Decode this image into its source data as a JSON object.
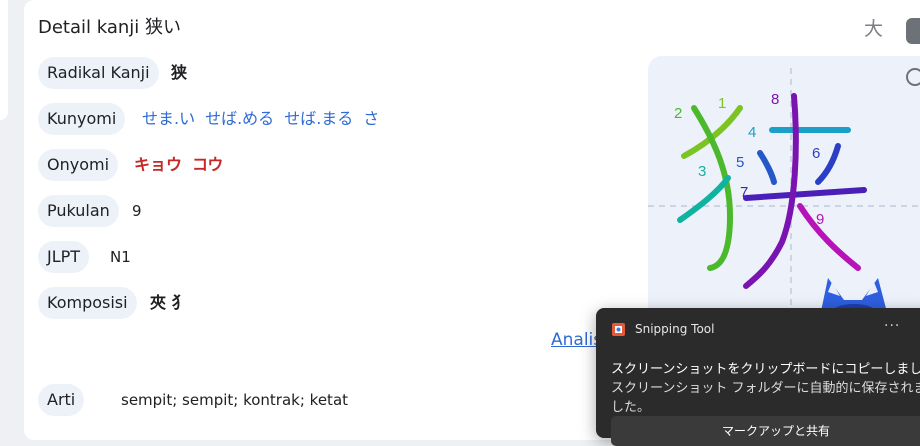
{
  "header": {
    "title": "Detail kanji 狭い",
    "dict_icon_glyph": "大"
  },
  "rows": {
    "radical": {
      "label": "Radikal Kanji",
      "value": "狭"
    },
    "kunyomi": {
      "label": "Kunyomi",
      "readings": [
        "せま.い",
        "せば.める",
        "せば.まる",
        "さ"
      ]
    },
    "onyomi": {
      "label": "Onyomi",
      "readings": [
        "キョウ",
        "コウ"
      ]
    },
    "strokes": {
      "label": "Pukulan",
      "value": "9"
    },
    "jlpt": {
      "label": "JLPT",
      "value": "N1"
    },
    "composition": {
      "label": "Komposisi",
      "value": "夾 犭"
    },
    "meaning": {
      "label": "Arti",
      "value": "sempit; sempit; kontrak; ketat"
    }
  },
  "analysis_link": "Analis",
  "stroke_order": {
    "numbers": [
      "1",
      "2",
      "3",
      "4",
      "5",
      "6",
      "7",
      "8",
      "9"
    ],
    "colors": [
      "#7cc423",
      "#4cb82b",
      "#10b3a0",
      "#1aa0c8",
      "#2457c8",
      "#2a3fc6",
      "#4a1fb8",
      "#7a14b0",
      "#b614b8"
    ]
  },
  "toast": {
    "app_name": "Snipping Tool",
    "more_label": "···",
    "message": "スクリーンショットをクリップボードにコピーしました",
    "detail": "スクリーンショット フォルダーに自動的に保存されました。",
    "button_label": "マークアップと共有"
  }
}
